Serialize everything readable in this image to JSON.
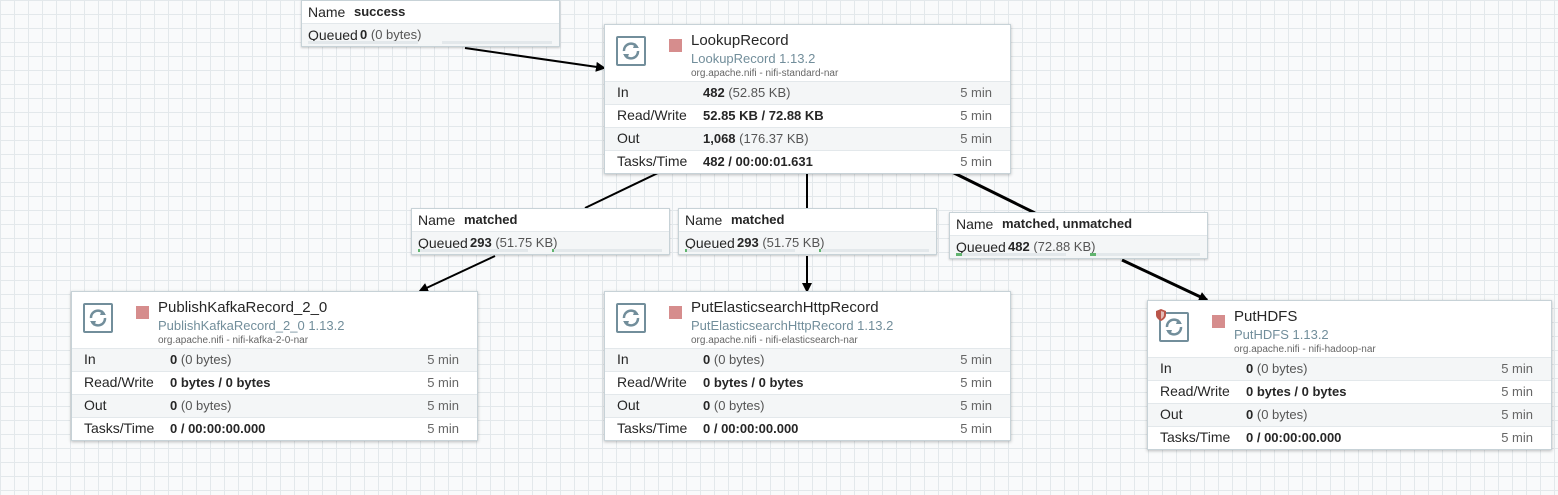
{
  "processors": {
    "lookup": {
      "name": "LookupRecord",
      "type": "LookupRecord 1.13.2",
      "bundle": "org.apache.nifi - nifi-standard-nar",
      "stats": [
        {
          "label": "In",
          "value": "482",
          "sub": "(52.85 KB)",
          "window": "5 min"
        },
        {
          "label": "Read/Write",
          "value": "52.85 KB / 72.88 KB",
          "sub": "",
          "window": "5 min"
        },
        {
          "label": "Out",
          "value": "1,068",
          "sub": "(176.37 KB)",
          "window": "5 min"
        },
        {
          "label": "Tasks/Time",
          "value": "482 / 00:00:01.631",
          "sub": "",
          "window": "5 min"
        }
      ]
    },
    "kafka": {
      "name": "PublishKafkaRecord_2_0",
      "type": "PublishKafkaRecord_2_0 1.13.2",
      "bundle": "org.apache.nifi - nifi-kafka-2-0-nar",
      "stats": [
        {
          "label": "In",
          "value": "0",
          "sub": "(0 bytes)",
          "window": "5 min"
        },
        {
          "label": "Read/Write",
          "value": "0 bytes / 0 bytes",
          "sub": "",
          "window": "5 min"
        },
        {
          "label": "Out",
          "value": "0",
          "sub": "(0 bytes)",
          "window": "5 min"
        },
        {
          "label": "Tasks/Time",
          "value": "0 / 00:00:00.000",
          "sub": "",
          "window": "5 min"
        }
      ]
    },
    "elastic": {
      "name": "PutElasticsearchHttpRecord",
      "type": "PutElasticsearchHttpRecord 1.13.2",
      "bundle": "org.apache.nifi - nifi-elasticsearch-nar",
      "stats": [
        {
          "label": "In",
          "value": "0",
          "sub": "(0 bytes)",
          "window": "5 min"
        },
        {
          "label": "Read/Write",
          "value": "0 bytes / 0 bytes",
          "sub": "",
          "window": "5 min"
        },
        {
          "label": "Out",
          "value": "0",
          "sub": "(0 bytes)",
          "window": "5 min"
        },
        {
          "label": "Tasks/Time",
          "value": "0 / 00:00:00.000",
          "sub": "",
          "window": "5 min"
        }
      ]
    },
    "hdfs": {
      "name": "PutHDFS",
      "type": "PutHDFS 1.13.2",
      "bundle": "org.apache.nifi - nifi-hadoop-nar",
      "stats": [
        {
          "label": "In",
          "value": "0",
          "sub": "(0 bytes)",
          "window": "5 min"
        },
        {
          "label": "Read/Write",
          "value": "0 bytes / 0 bytes",
          "sub": "",
          "window": "5 min"
        },
        {
          "label": "Out",
          "value": "0",
          "sub": "(0 bytes)",
          "window": "5 min"
        },
        {
          "label": "Tasks/Time",
          "value": "0 / 00:00:00.000",
          "sub": "",
          "window": "5 min"
        }
      ]
    }
  },
  "connections": {
    "success": {
      "name_label": "Name",
      "name": "success",
      "queued_label": "Queued",
      "queued": "0",
      "queued_sub": "(0 bytes)",
      "fill": 0
    },
    "matched_kafka": {
      "name_label": "Name",
      "name": "matched",
      "queued_label": "Queued",
      "queued": "293",
      "queued_sub": "(51.75 KB)",
      "fill": 0.02
    },
    "matched_elastic": {
      "name_label": "Name",
      "name": "matched",
      "queued_label": "Queued",
      "queued": "293",
      "queued_sub": "(51.75 KB)",
      "fill": 0.02
    },
    "matched_unmatched": {
      "name_label": "Name",
      "name": "matched, unmatched",
      "queued_label": "Queued",
      "queued": "482",
      "queued_sub": "(72.88 KB)",
      "fill": 0.05
    }
  },
  "colors": {
    "stopped": "#d68d8d",
    "icon": "#728e9b",
    "queue_fill": "#61b46f",
    "edge": "#000000"
  },
  "icons": {
    "processor": "processor-icon",
    "stopped": "stop-icon",
    "restricted": "restricted-shield-icon"
  }
}
